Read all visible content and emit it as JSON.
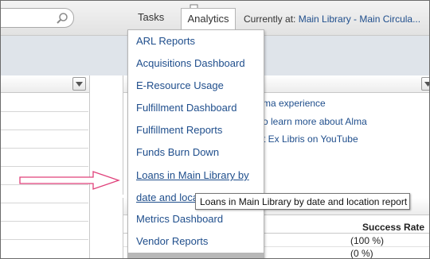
{
  "header": {
    "tabs": [
      {
        "label": "Tasks"
      },
      {
        "label": "Analytics",
        "active": true
      }
    ],
    "currently_at_label": "Currently at:",
    "currently_at_value": "Main Library - Main Circula..."
  },
  "analytics_menu": {
    "items": [
      {
        "label": "ARL Reports"
      },
      {
        "label": "Acquisitions Dashboard"
      },
      {
        "label": "E-Resource Usage"
      },
      {
        "label": "Fulfillment Dashboard"
      },
      {
        "label": "Fulfillment Reports"
      },
      {
        "label": "Funds Burn Down"
      },
      {
        "label": "Loans in Main Library by"
      },
      {
        "label": "date and loca"
      },
      {
        "label": "Metrics Dashboard"
      },
      {
        "label": "Vendor Reports"
      }
    ],
    "hovered_item": "Loans in Main Library by date and location report"
  },
  "tooltip": {
    "text": "Loans in Main Library by date and location report"
  },
  "right_widget": {
    "links": [
      {
        "text": "ma experience"
      },
      {
        "text": "o learn more about Alma"
      },
      {
        "text": "t Ex Libris on YouTube"
      }
    ]
  },
  "bottom_widget": {
    "column_header": "Success Rate",
    "values": [
      "(100 %)",
      "(0 %)"
    ]
  },
  "colors": {
    "link": "#1f4e8c",
    "arrow": "#e0407a",
    "header_bg": "#e9e9e9"
  },
  "icons": {
    "search": "search-icon",
    "bubble": "speech-bubble-icon",
    "dropdown": "chevron-down-icon",
    "arrow": "pointer-arrow"
  }
}
